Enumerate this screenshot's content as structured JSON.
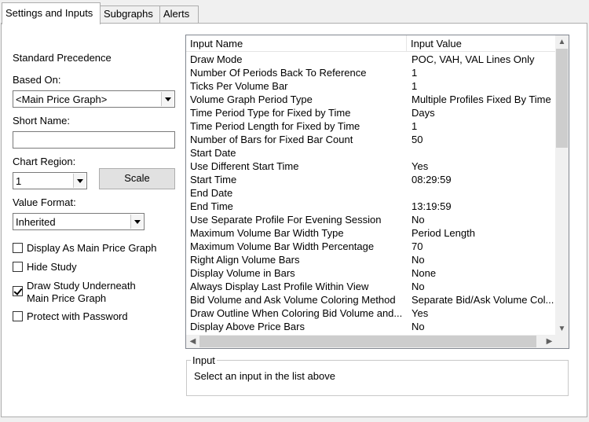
{
  "tabs": [
    {
      "label": "Settings and Inputs",
      "active": true
    },
    {
      "label": "Subgraphs",
      "active": false
    },
    {
      "label": "Alerts",
      "active": false
    }
  ],
  "left": {
    "precedence": "Standard Precedence",
    "based_on_label": "Based On:",
    "based_on_value": "<Main Price Graph>",
    "short_name_label": "Short Name:",
    "short_name_value": "",
    "chart_region_label": "Chart Region:",
    "chart_region_value": "1",
    "scale_button": "Scale",
    "value_format_label": "Value Format:",
    "value_format_value": "Inherited",
    "checkboxes": [
      {
        "label": "Display As Main Price Graph",
        "checked": false
      },
      {
        "label": "Hide Study",
        "checked": false
      },
      {
        "label": "Draw Study Underneath",
        "label2": "Main Price Graph",
        "checked": true
      },
      {
        "label": "Protect with Password",
        "checked": false
      }
    ]
  },
  "grid": {
    "headers": [
      "Input Name",
      "Input Value"
    ],
    "rows": [
      [
        "Draw Mode",
        "POC, VAH, VAL Lines Only"
      ],
      [
        "Number Of Periods Back To Reference",
        "1"
      ],
      [
        "Ticks Per Volume Bar",
        "1"
      ],
      [
        "Volume Graph Period Type",
        "Multiple Profiles Fixed By Time"
      ],
      [
        "Time Period Type for Fixed by Time",
        "Days"
      ],
      [
        "Time Period Length for Fixed by Time",
        "1"
      ],
      [
        "Number of Bars for Fixed Bar Count",
        "50"
      ],
      [
        "Start Date",
        ""
      ],
      [
        "Use Different Start Time",
        "Yes"
      ],
      [
        "Start Time",
        "08:29:59"
      ],
      [
        "End Date",
        ""
      ],
      [
        "End Time",
        "13:19:59"
      ],
      [
        "Use Separate Profile For Evening Session",
        "No"
      ],
      [
        "Maximum Volume Bar Width Type",
        "Period Length"
      ],
      [
        "Maximum Volume Bar Width Percentage",
        "70"
      ],
      [
        "Right Align Volume Bars",
        "No"
      ],
      [
        "Display Volume in Bars",
        "None"
      ],
      [
        "Always Display Last Profile Within View",
        "No"
      ],
      [
        "Bid Volume and Ask Volume Coloring Method",
        "Separate Bid/Ask Volume Col..."
      ],
      [
        "Draw Outline When Coloring Bid Volume and...",
        "Yes"
      ],
      [
        "Display Above Price Bars",
        "No"
      ]
    ]
  },
  "input_group": {
    "title": "Input",
    "text": "Select an input in the list above"
  },
  "icons": {
    "scroll_up": "▲",
    "scroll_down": "▼",
    "scroll_left": "◀",
    "scroll_right": "▶"
  }
}
